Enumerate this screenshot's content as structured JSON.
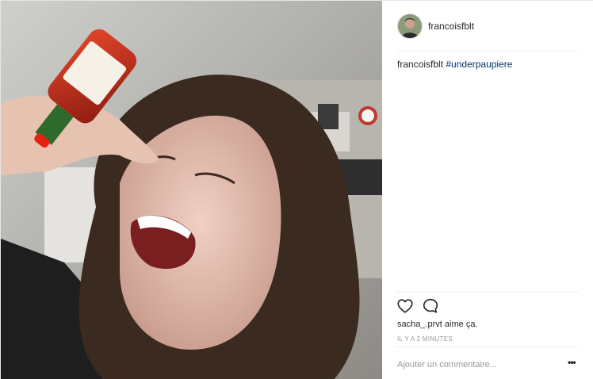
{
  "post": {
    "photo": {
      "description_icon": "photo-image"
    },
    "header": {
      "username": "francoisfblt",
      "avatar_icon": "avatar-icon"
    },
    "caption": {
      "username": "francoisfblt",
      "hashtag": "#underpaupiere"
    },
    "actions": {
      "like_icon": "heart-icon",
      "comment_icon": "comment-icon"
    },
    "likes": {
      "liker": "sacha_.prvt",
      "suffix": " aime ça."
    },
    "timestamp": "IL Y A 2 MINUTES",
    "comment_box": {
      "placeholder": "Ajouter un commentaire...",
      "more_label": "•••"
    }
  },
  "colors": {
    "hashtag": "#003569",
    "border": "#efefef",
    "muted": "#999999",
    "text": "#262626"
  }
}
